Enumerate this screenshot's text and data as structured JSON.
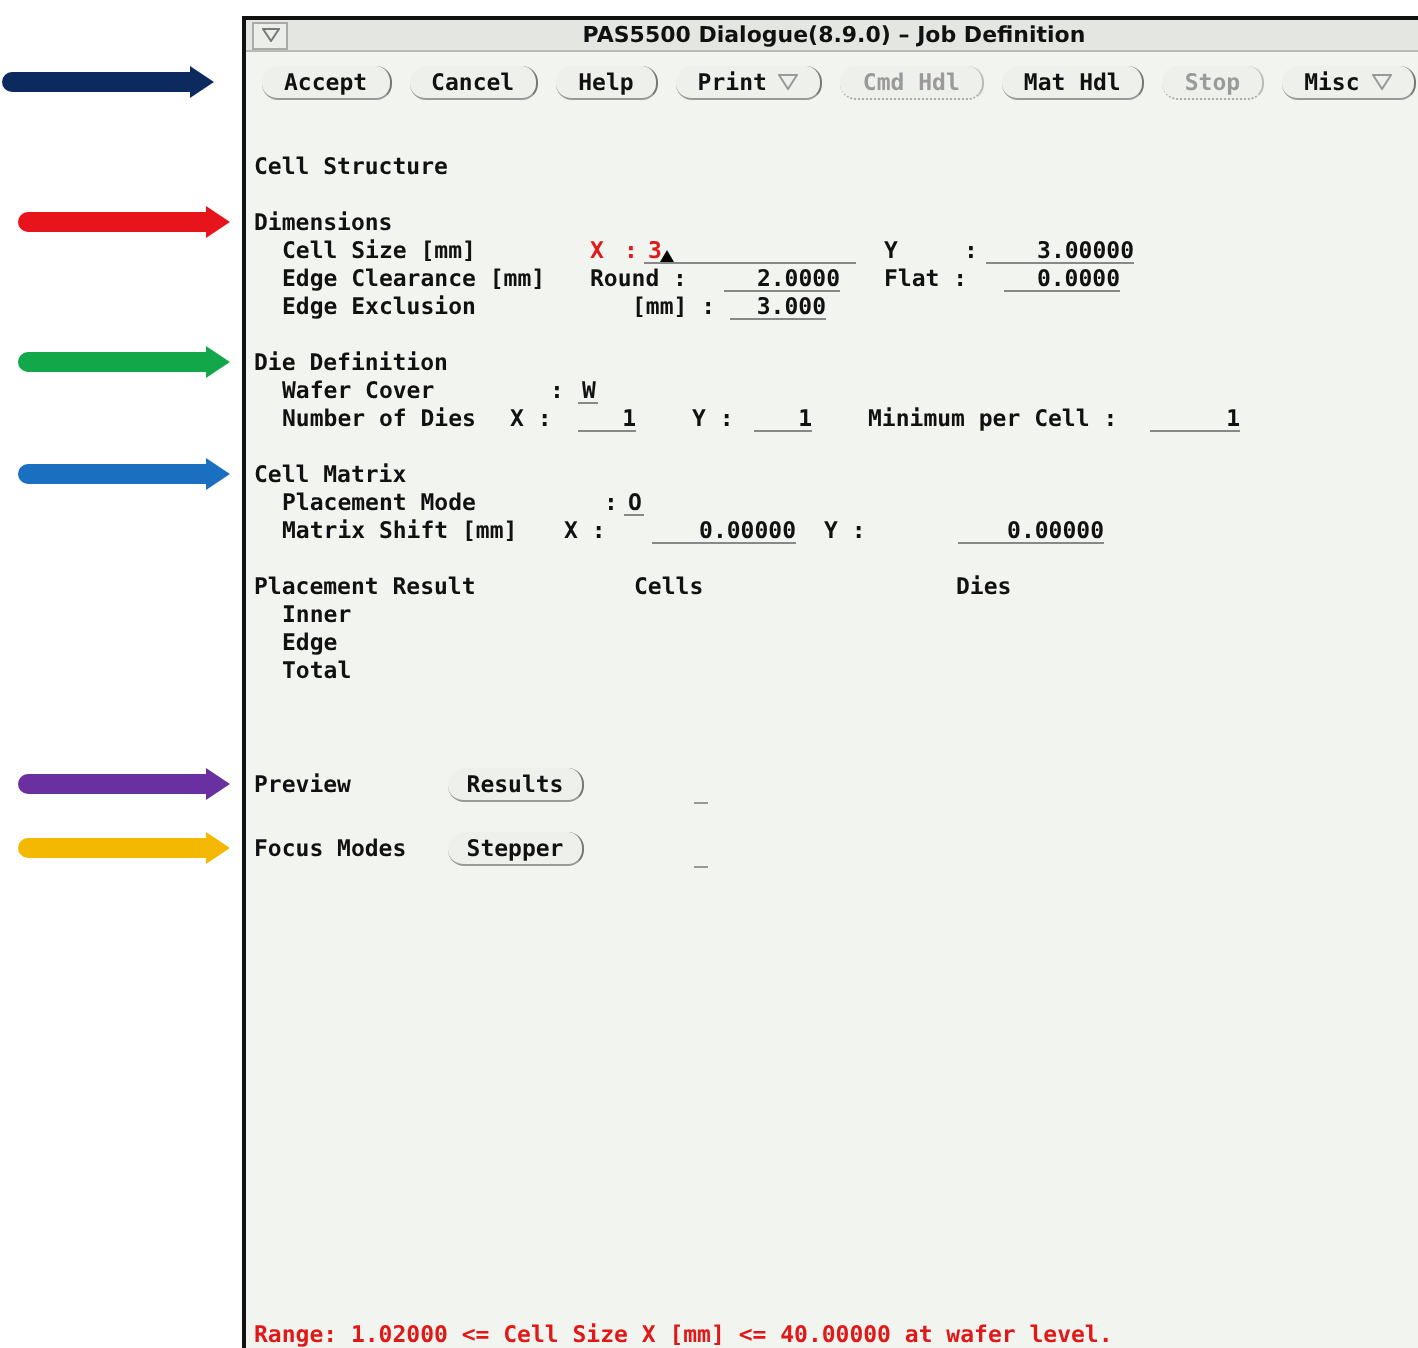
{
  "window": {
    "title": "PAS5500 Dialogue(8.9.0) – Job Definition"
  },
  "toolbar": {
    "arrow": {
      "color": "#0c2a5e"
    },
    "buttons": [
      {
        "label": "Accept",
        "disabled": false,
        "has_menu": false
      },
      {
        "label": "Cancel",
        "disabled": false,
        "has_menu": false
      },
      {
        "label": "Help",
        "disabled": false,
        "has_menu": false
      },
      {
        "label": "Print",
        "disabled": false,
        "has_menu": true
      },
      {
        "label": "Cmd Hdl",
        "disabled": true,
        "has_menu": false
      },
      {
        "label": "Mat Hdl",
        "disabled": false,
        "has_menu": false
      },
      {
        "label": "Stop",
        "disabled": true,
        "has_menu": false
      },
      {
        "label": "Misc",
        "disabled": false,
        "has_menu": true
      }
    ]
  },
  "heading": "Cell Structure",
  "dimensions": {
    "title": "Dimensions",
    "arrow": {
      "color": "#e8141c"
    },
    "cell_size": {
      "label": "Cell Size [mm]",
      "x_label": "X",
      "x_separator": ":",
      "x_value": "3",
      "x_error": true,
      "y_label": "Y",
      "y_separator": ":",
      "y_value": "3.00000"
    },
    "edge_clearance": {
      "label": "Edge Clearance [mm]",
      "round_label": "Round :",
      "round_value": "2.0000",
      "flat_label": "Flat :",
      "flat_value": "0.0000"
    },
    "edge_exclusion": {
      "label": "Edge Exclusion",
      "unit_label": "[mm] :",
      "value": "3.000"
    }
  },
  "die_definition": {
    "title": "Die Definition",
    "arrow": {
      "color": "#12a84a"
    },
    "wafer_cover": {
      "label": "Wafer Cover",
      "separator": ":",
      "value": "W"
    },
    "number_of_dies": {
      "label": "Number of Dies",
      "x_label": "X :",
      "x_value": "1",
      "y_label": "Y :",
      "y_value": "1",
      "minimum_label": "Minimum per Cell :",
      "minimum_value": "1"
    }
  },
  "cell_matrix": {
    "title": "Cell Matrix",
    "arrow": {
      "color": "#1a6fc0"
    },
    "placement_mode": {
      "label": "Placement Mode",
      "separator": ":",
      "value": "O"
    },
    "matrix_shift": {
      "label": "Matrix Shift [mm]",
      "x_label": "X :",
      "x_value": "0.00000",
      "y_label": "Y :",
      "y_value": "0.00000"
    }
  },
  "placement_result": {
    "title": "Placement Result",
    "columns": [
      "Cells",
      "Dies"
    ],
    "rows": [
      "Inner",
      "Edge",
      "Total"
    ]
  },
  "preview": {
    "label": "Preview",
    "button": "Results",
    "arrow": {
      "color": "#6a2fa0"
    }
  },
  "focus_modes": {
    "label": "Focus Modes",
    "button": "Stepper",
    "arrow": {
      "color": "#f5b800"
    }
  },
  "status_message": "Range: 1.02000 <= Cell Size X [mm] <= 40.00000 at wafer level."
}
